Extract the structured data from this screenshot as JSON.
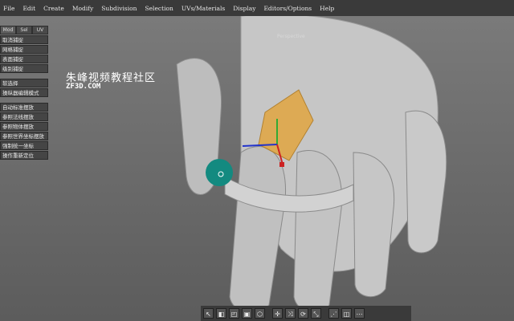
{
  "menu": [
    "File",
    "Edit",
    "Create",
    "Modify",
    "Subdivision",
    "Selection",
    "UVs/Materials",
    "Display",
    "Editors/Options",
    "Help"
  ],
  "viewport": {
    "label": "Perspective"
  },
  "watermark": {
    "title": "朱峰视频教程社区",
    "site": "ZF3D.COM"
  },
  "side_tabs": [
    "Mod",
    "Sel",
    "UV"
  ],
  "side_groups": [
    [
      "取消捕捉",
      "网格捕捉",
      "表面捕捉",
      "级别捕捉"
    ],
    [
      "软选择",
      "操纵器编辑模式"
    ],
    [
      "自动标准摆放",
      "参照法线摆放",
      "参照物体摆放",
      "参照世界坐标摆放",
      "强制统一坐标",
      "操作重新定位"
    ]
  ],
  "tools": [
    "↖",
    "◧",
    "◰",
    "▣",
    "⬡",
    "✛",
    "⤨",
    "⟳",
    "⤡",
    "⋰",
    "◫",
    "⋯"
  ]
}
